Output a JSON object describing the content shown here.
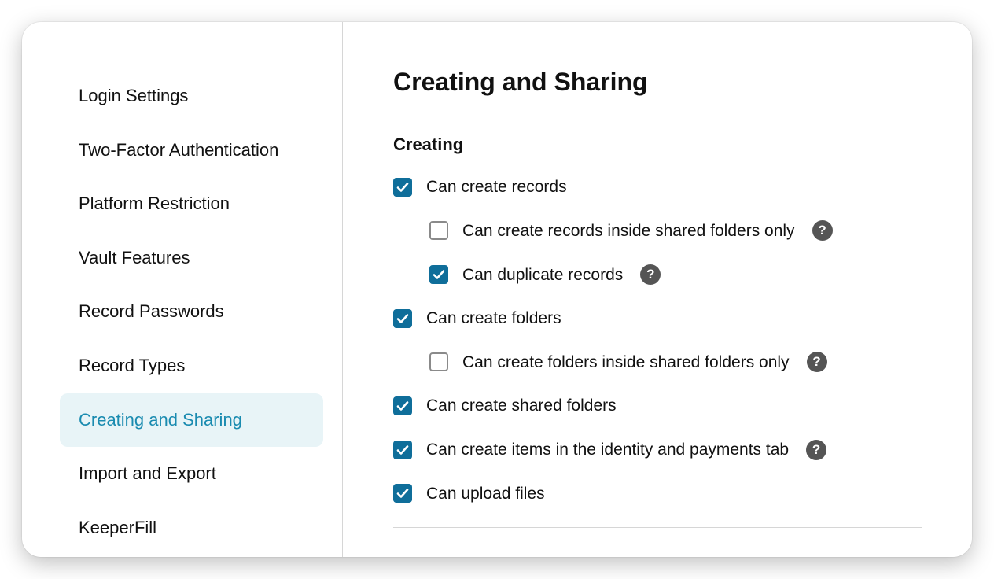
{
  "sidebar": {
    "items": [
      {
        "label": "Login Settings",
        "active": false
      },
      {
        "label": "Two-Factor Authentication",
        "active": false
      },
      {
        "label": "Platform Restriction",
        "active": false
      },
      {
        "label": "Vault Features",
        "active": false
      },
      {
        "label": "Record Passwords",
        "active": false
      },
      {
        "label": "Record Types",
        "active": false
      },
      {
        "label": "Creating and Sharing",
        "active": true
      },
      {
        "label": "Import and Export",
        "active": false
      },
      {
        "label": "KeeperFill",
        "active": false
      }
    ]
  },
  "main": {
    "title": "Creating and Sharing",
    "section_creating": {
      "heading": "Creating",
      "options": [
        {
          "label": "Can create records",
          "checked": true,
          "indent": false,
          "help": false
        },
        {
          "label": "Can create records inside shared folders only",
          "checked": false,
          "indent": true,
          "help": true
        },
        {
          "label": "Can duplicate records",
          "checked": true,
          "indent": true,
          "help": true
        },
        {
          "label": "Can create folders",
          "checked": true,
          "indent": false,
          "help": false
        },
        {
          "label": "Can create folders inside shared folders only",
          "checked": false,
          "indent": true,
          "help": true
        },
        {
          "label": "Can create shared folders",
          "checked": true,
          "indent": false,
          "help": false
        },
        {
          "label": "Can create items in the identity and payments tab",
          "checked": true,
          "indent": false,
          "help": true
        },
        {
          "label": "Can upload files",
          "checked": true,
          "indent": false,
          "help": false
        }
      ]
    }
  }
}
